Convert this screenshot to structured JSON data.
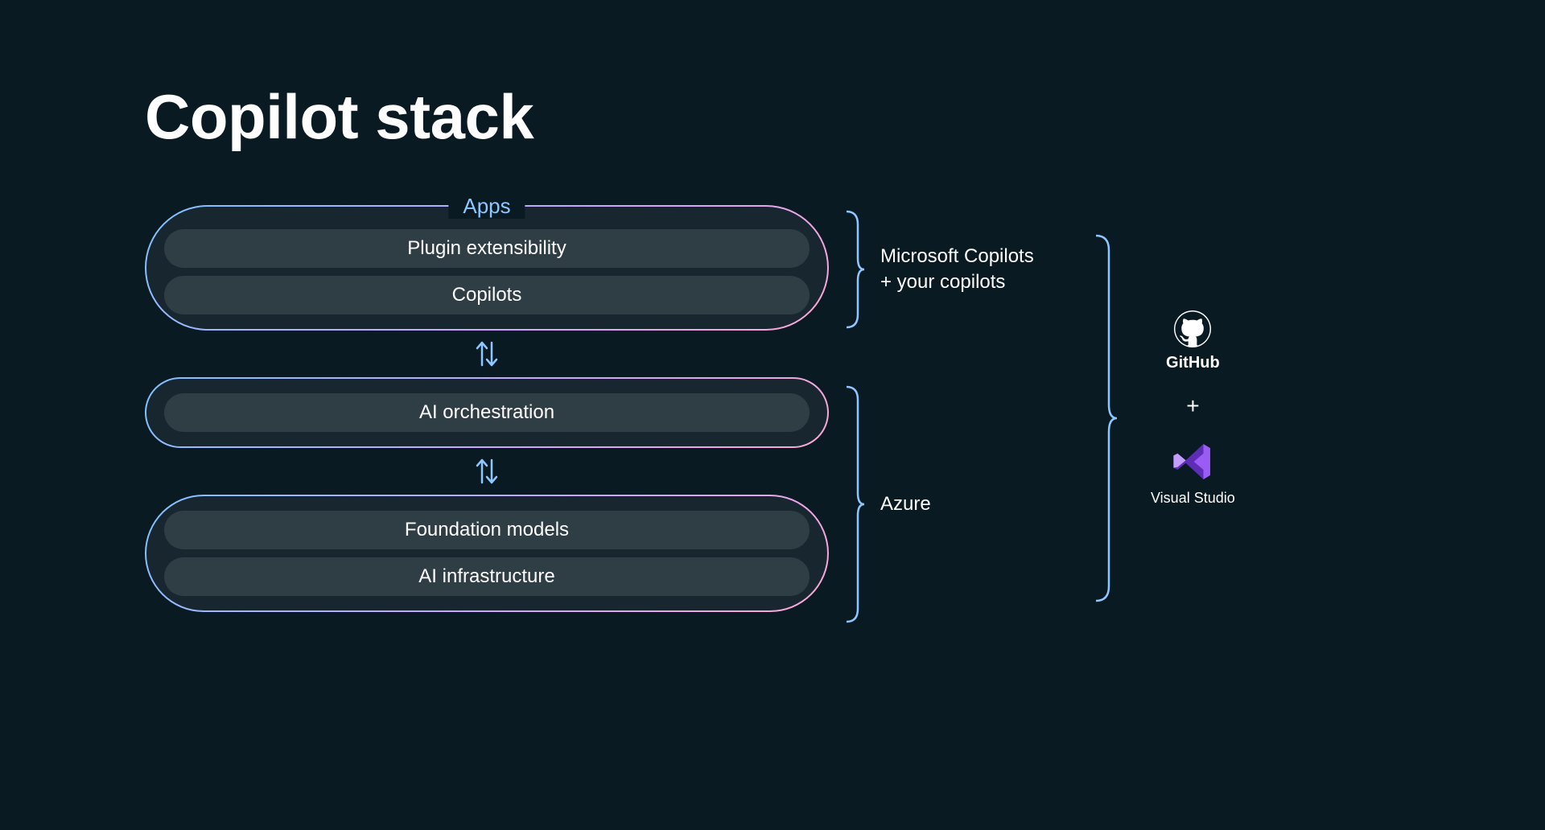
{
  "title": "Copilot stack",
  "blocks": {
    "apps": {
      "label": "Apps",
      "pills": [
        "Plugin extensibility",
        "Copilots"
      ]
    },
    "orchestration": {
      "pill": "AI orchestration"
    },
    "foundation": {
      "pills": [
        "Foundation models",
        "AI infrastructure"
      ]
    }
  },
  "brackets": {
    "top": {
      "line1": "Microsoft Copilots",
      "line2": "+ your copilots"
    },
    "bottom": {
      "label": "Azure"
    }
  },
  "tools": {
    "github": "GitHub",
    "plus": "+",
    "vs": "Visual Studio"
  }
}
